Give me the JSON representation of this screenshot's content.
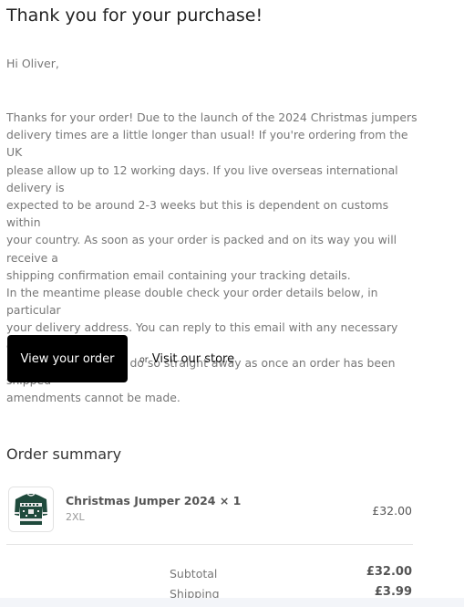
{
  "email": {
    "title": "Thank you for your purchase!",
    "greeting": "Hi Oliver,",
    "message_lines": [
      "Thanks for your order! Due to the launch of the 2024 Christmas jumpers",
      "delivery times are a little longer than usual! If you're ordering from the UK",
      "please allow up to 12 working days. If you live overseas international delivery is",
      "expected to be around 2-3 weeks but this is dependent on customs within",
      "your country. As soon as your order is packed and on its way you will receive a",
      "shipping confirmation email containing your tracking details.",
      "In the meantime please double check your order details below, in particular",
      "your delivery address. You can reply to this email with any necessary changes,",
      "but please be sure to do so straight away as once an order has been shipped",
      "amendments cannot be made."
    ]
  },
  "actions": {
    "view_order": "View your order",
    "or_text": "or",
    "visit_store": "Visit our store"
  },
  "summary": {
    "title": "Order summary",
    "item": {
      "name": "Christmas Jumper 2024 × 1",
      "variant": "2XL",
      "price": "£32.00"
    },
    "subtotal_label": "Subtotal",
    "subtotal_value": "£32.00",
    "shipping_label": "Shipping",
    "shipping_value": "£3.99"
  },
  "colors": {
    "button_bg": "#000000",
    "body_text": "#777777",
    "jumper": "#1f4a3c"
  }
}
